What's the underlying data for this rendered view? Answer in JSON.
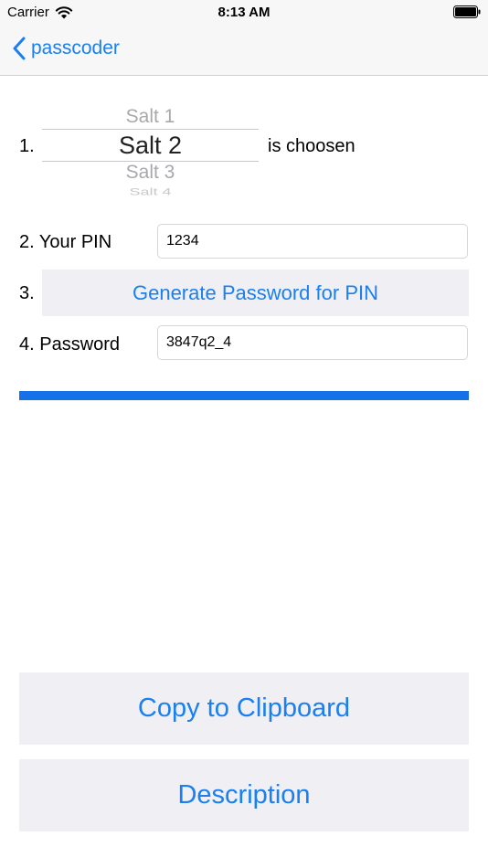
{
  "status_bar": {
    "carrier": "Carrier",
    "time": "8:13 AM"
  },
  "nav": {
    "back_label": "passcoder",
    "accent_color": "#1a7ff0"
  },
  "step1": {
    "num": "1.",
    "picker_items": [
      "Salt 1",
      "Salt 2",
      "Salt 3",
      "Salt 4"
    ],
    "selected": "Salt 2",
    "suffix": "is choosen"
  },
  "step2": {
    "label": "2. Your PIN",
    "value": "1234"
  },
  "step3": {
    "num": "3.",
    "button_label": "Generate Password for PIN"
  },
  "step4": {
    "label": "4. Password",
    "value": "3847q2_4"
  },
  "progress": {
    "fraction": 1.0
  },
  "buttons": {
    "copy_label": "Copy to Clipboard",
    "description_label": "Description"
  }
}
